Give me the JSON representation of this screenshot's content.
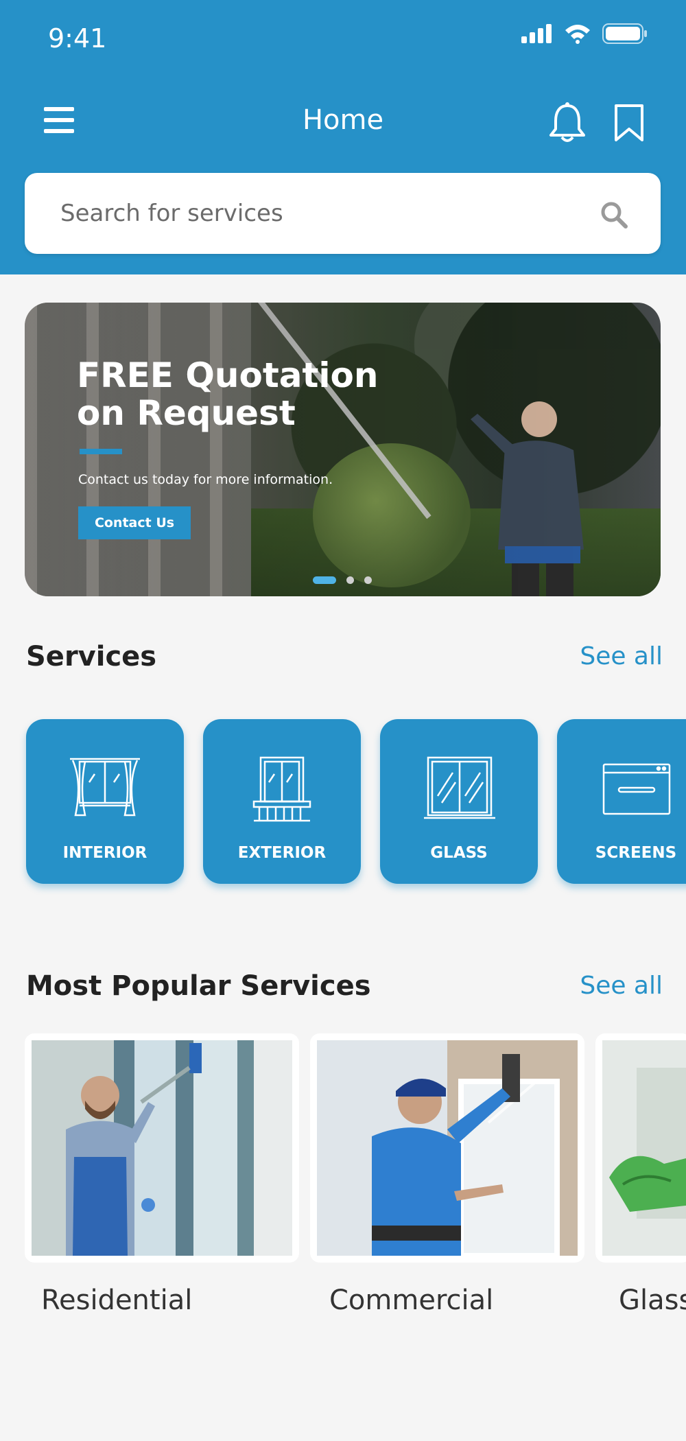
{
  "status": {
    "time": "9:41"
  },
  "navbar": {
    "title": "Home"
  },
  "search": {
    "placeholder": "Search for services"
  },
  "banner": {
    "title": "FREE Quotation on Request",
    "subtitle": "Contact us today for more information.",
    "button_label": "Contact Us"
  },
  "services": {
    "title": "Services",
    "see_all": "See all",
    "items": [
      {
        "label": "INTERIOR",
        "icon": "curtain-window-icon"
      },
      {
        "label": "EXTERIOR",
        "icon": "balcony-window-icon"
      },
      {
        "label": "GLASS",
        "icon": "glass-pane-icon"
      },
      {
        "label": "SCREENS",
        "icon": "screen-panel-icon"
      }
    ]
  },
  "popular": {
    "title": "Most Popular Services",
    "see_all": "See all",
    "items": [
      {
        "label": "Residential"
      },
      {
        "label": "Commercial"
      },
      {
        "label": "Glass"
      }
    ]
  },
  "colors": {
    "primary": "#2691c8",
    "background": "#f5f5f5"
  }
}
